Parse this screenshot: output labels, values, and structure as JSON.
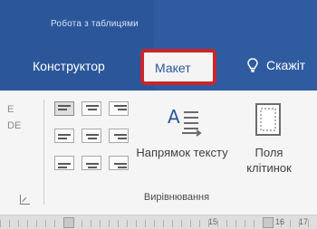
{
  "context_tab_group": "Робота з таблицями",
  "tabs": {
    "constructor": "Конструктор",
    "layout": "Макет",
    "tell_me": "Скажіт"
  },
  "alignment_group": {
    "buttons": [
      "top-left",
      "top-center",
      "top-right",
      "middle-left",
      "middle-center",
      "middle-right",
      "bottom-left",
      "bottom-center",
      "bottom-right"
    ],
    "text_direction": "Напрямок тексту",
    "cell_margins": "Поля клітинок",
    "label": "Вирівнювання"
  },
  "left_marks": "E\nDE",
  "ruler": {
    "labels": [
      "15",
      "16",
      "17"
    ]
  },
  "colors": {
    "ribbon_blue": "#2b579a",
    "highlight": "#c9262b"
  }
}
